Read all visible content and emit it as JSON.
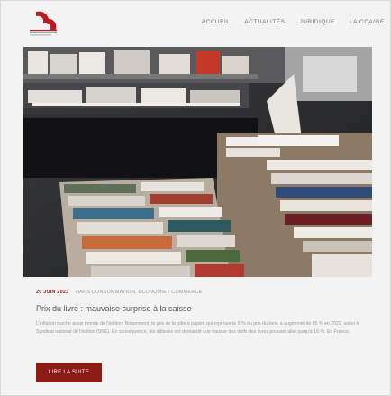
{
  "nav": {
    "items": [
      "ACCUEIL",
      "ACTUALITÉS",
      "JURIDIQUE",
      "LA CCA/GE"
    ]
  },
  "hero": {
    "image": "bookshop-table-with-stacked-books"
  },
  "article": {
    "date": "20 JUIN 2023",
    "categories": "DANS CONSOMMATION, ECONOMIE / COMMERCE",
    "title": "Prix du livre : mauvaise surprise à la caisse",
    "excerpt": "L'inflation touche aussi monde de l'édition. Notamment, le prix de la pâte à papier, qui représente 5 % du prix du livre, a augmenté de 85 % en 2022, selon le Syndicat national de l'édition (SNE). En conséquence, les éditeurs ont demandé une hausse des tarifs des livres pouvant aller jusqu'à 16 %. En France,",
    "button": "LIRE LA SUITE"
  },
  "colors": {
    "accent": "#8d1c16",
    "background": "#f3f3f3"
  }
}
